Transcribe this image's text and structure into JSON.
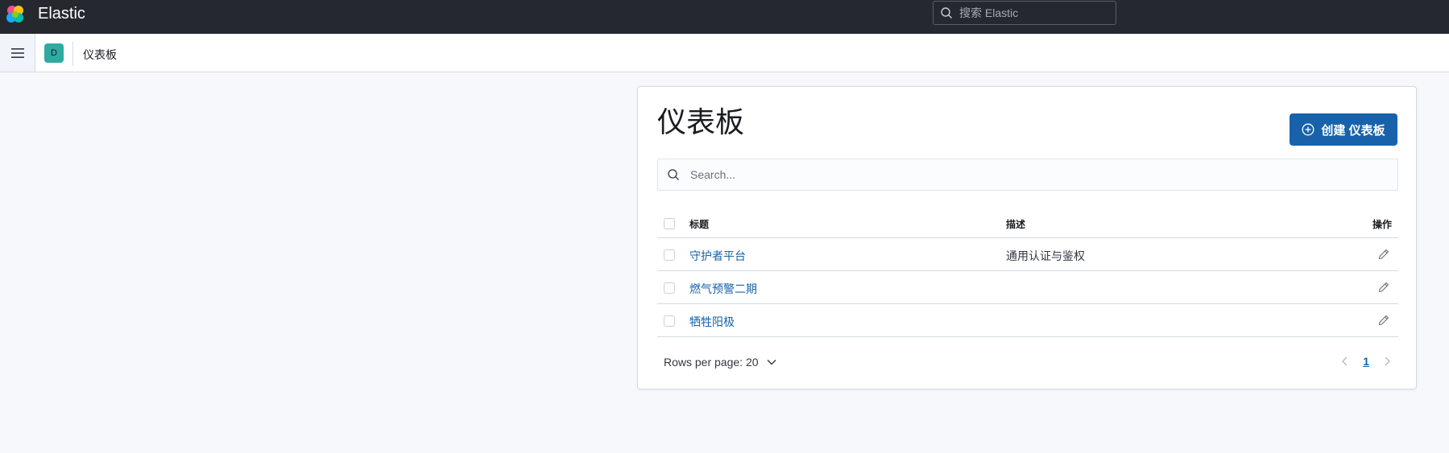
{
  "header": {
    "brand": "Elastic",
    "search_placeholder": "搜索 Elastic"
  },
  "navbar": {
    "space_initial": "D",
    "breadcrumb": "仪表板"
  },
  "page": {
    "title": "仪表板",
    "create_button_label": "创建 仪表板",
    "search_placeholder": "Search..."
  },
  "table": {
    "columns": {
      "title": "标题",
      "description": "描述",
      "actions": "操作"
    },
    "rows": [
      {
        "title": "守护者平台",
        "description": "通用认证与鉴权"
      },
      {
        "title": "燃气预警二期",
        "description": ""
      },
      {
        "title": "牺牲阳极",
        "description": ""
      }
    ]
  },
  "pagination": {
    "rows_per_page": "Rows per page: 20",
    "current_page": "1"
  },
  "colors": {
    "header_bg": "#25282f",
    "accent": "#1762ab",
    "space_avatar": "#2eaaa1"
  }
}
